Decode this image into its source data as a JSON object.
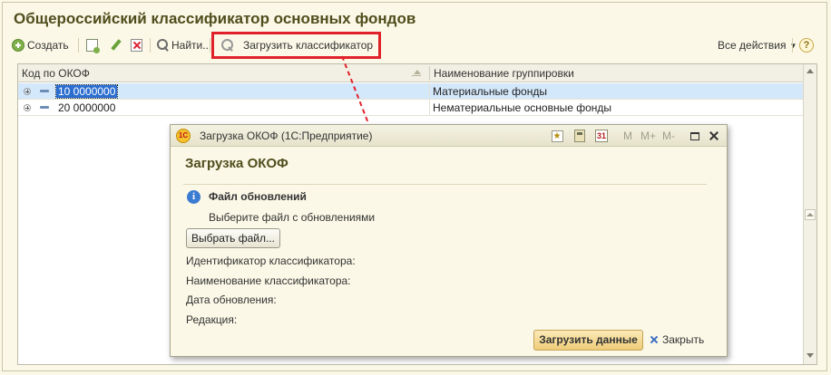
{
  "main": {
    "title": "Общероссийский классификатор основных фондов"
  },
  "toolbar": {
    "create_label": "Создать",
    "find_label": "Найти...",
    "load_classifier_label": "Загрузить классификатор",
    "all_actions_label": "Все действия",
    "help_label": "?"
  },
  "grid": {
    "columns": [
      "Код по ОКОФ",
      "Наименование группировки"
    ],
    "rows": [
      {
        "code": "10 0000000",
        "name": "Материальные фонды",
        "selected": true
      },
      {
        "code": "20 0000000",
        "name": "Нематериальные основные фонды",
        "selected": false
      }
    ]
  },
  "dialog": {
    "window_title": "Загрузка ОКОФ  (1С:Предприятие)",
    "logo_text": "1С",
    "m_buttons": [
      "M",
      "M+",
      "M-"
    ],
    "calendar_label": "31",
    "heading": "Загрузка ОКОФ",
    "section_title": "Файл обновлений",
    "hint": "Выберите файл с обновлениями",
    "pick_file_label": "Выбрать файл...",
    "fields": [
      "Идентификатор классификатора:",
      "Наименование классификатора:",
      "Дата обновления:",
      "Редакция:"
    ],
    "load_data_label": "Загрузить данные",
    "close_label": "Закрыть"
  },
  "colors": {
    "highlight": "#e1212a",
    "selected_row": "#d4e8fb",
    "title_text": "#4e4e1d",
    "primary_button": "#efcd79"
  }
}
